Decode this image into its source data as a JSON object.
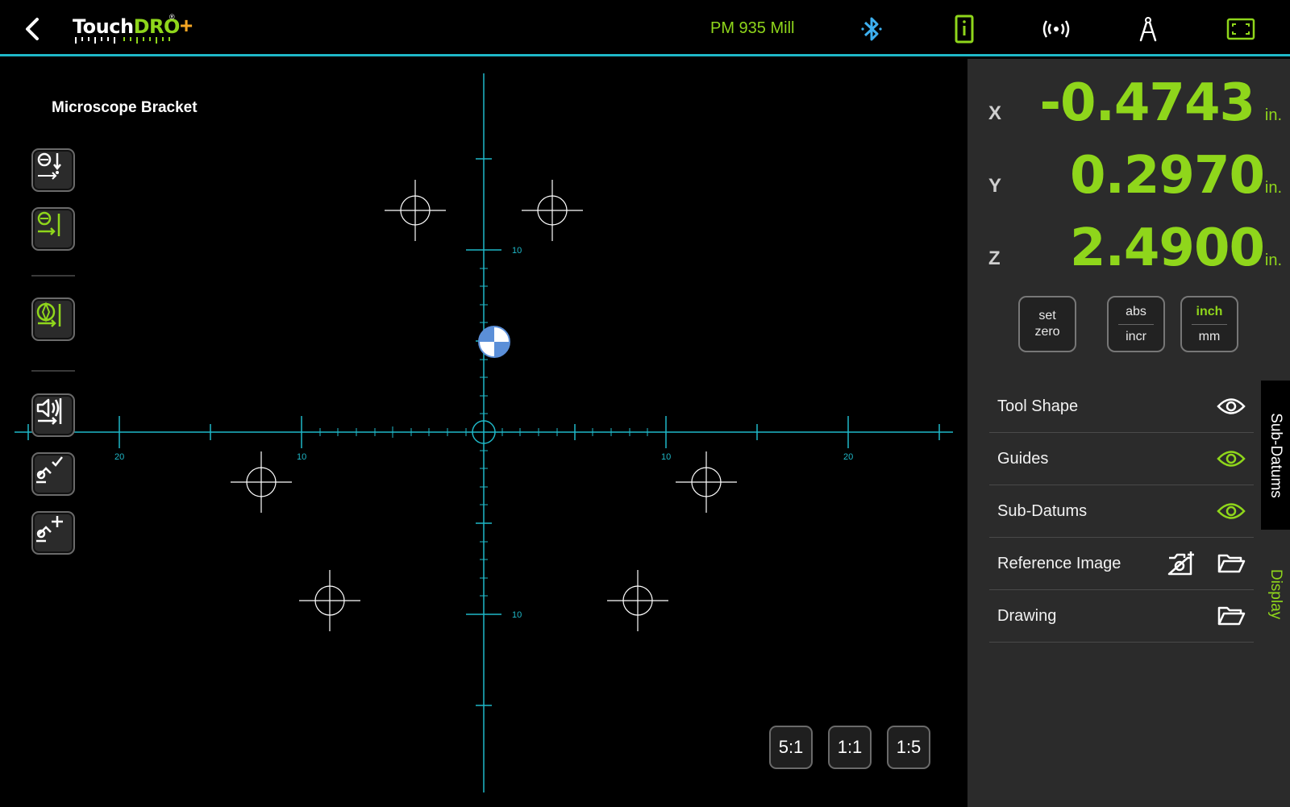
{
  "header": {
    "logo": {
      "touch": "Touch",
      "dro": "DRO",
      "plus": "+",
      "reg": "®"
    },
    "machine_name": "PM 935 Mill",
    "icons": [
      "back-icon",
      "bluetooth-icon",
      "device-info-icon",
      "wireless-signal-icon",
      "compass-icon",
      "fullscreen-icon"
    ]
  },
  "canvas": {
    "project_title": "Microscope Bracket",
    "axis_labels": {
      "x_left_20": "20",
      "x_left_10": "10",
      "x_right_10": "10",
      "x_right_20": "20",
      "y_top_10": "10",
      "y_bottom_10": "10"
    },
    "zoom_buttons": [
      "5:1",
      "1:1",
      "1:5"
    ]
  },
  "readouts": [
    {
      "axis": "X",
      "value": "-0.4743",
      "unit": "in."
    },
    {
      "axis": "Y",
      "value": "0.2970",
      "unit": "in."
    },
    {
      "axis": "Z",
      "value": "2.4900",
      "unit": "in."
    }
  ],
  "mode_buttons": {
    "set_zero": {
      "line1": "set",
      "line2": "zero"
    },
    "abs_incr": {
      "top": "abs",
      "bottom": "incr"
    },
    "units": {
      "top": "inch",
      "bottom": "mm"
    }
  },
  "display_list": [
    {
      "label": "Tool Shape",
      "icon": "eye-icon",
      "color": "#ffffff"
    },
    {
      "label": "Guides",
      "icon": "eye-icon",
      "color": "#8fd61b"
    },
    {
      "label": "Sub-Datums",
      "icon": "eye-icon",
      "color": "#8fd61b"
    },
    {
      "label": "Reference Image",
      "icons": [
        "add-photo-icon",
        "folder-open-icon"
      ]
    },
    {
      "label": "Drawing",
      "icons": [
        "folder-open-icon"
      ]
    }
  ],
  "side_tabs": {
    "subdatums": "Sub-Datums",
    "display": "Display"
  },
  "colors": {
    "accent_green": "#8fd61b",
    "axis_cyan": "#1fb8c8",
    "bluetooth_blue": "#3db0f0",
    "tool_blue": "#5b8fd8"
  }
}
